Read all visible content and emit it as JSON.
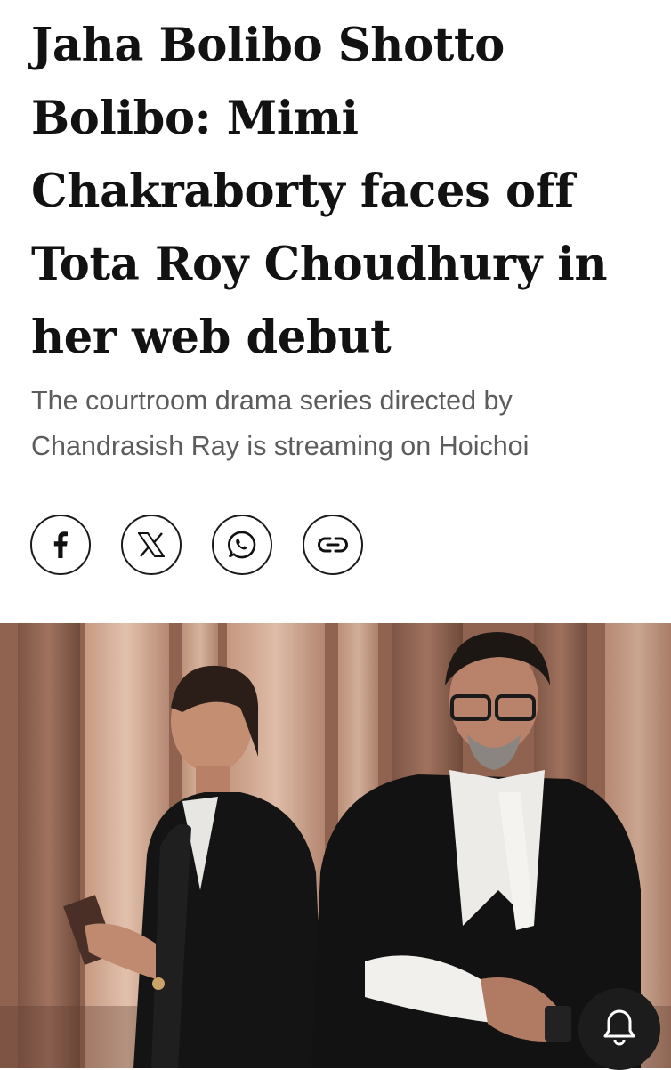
{
  "article": {
    "headline": "Jaha Bolibo Shotto Bolibo: Mimi Chakraborty faces off Tota Roy Choudhury in her web debut",
    "subheadline": "The courtroom drama series directed by Chandrasish Ray is streaming on Hoichoi"
  },
  "share": {
    "buttons": [
      {
        "icon": "facebook-icon"
      },
      {
        "icon": "x-icon"
      },
      {
        "icon": "whatsapp-icon"
      },
      {
        "icon": "link-icon"
      }
    ]
  },
  "hero_image": {
    "description_icon": "photo"
  },
  "notification": {
    "icon": "bell-icon"
  },
  "colors": {
    "text": "#121212",
    "subtext": "#5c5c5c",
    "border": "#1a1a1a",
    "bell_bg": "#1c1c1c"
  }
}
